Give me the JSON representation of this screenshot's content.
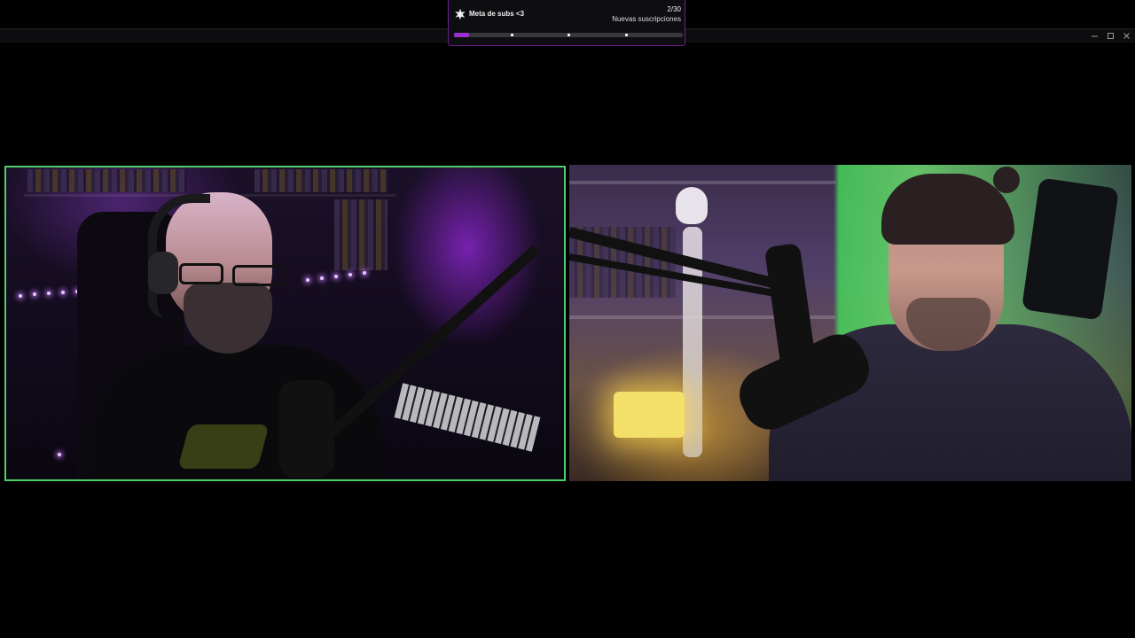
{
  "window": {
    "controls": [
      "minimize",
      "maximize",
      "close"
    ]
  },
  "goal": {
    "title": "Meta de subs <3",
    "count": "2/30",
    "subtitle": "Nuevas suscripciones",
    "progress": 0.067,
    "milestone_fractions": [
      0.25,
      0.5,
      0.75
    ],
    "icon": "star-burst-icon",
    "accent_color": "#9b2fd0",
    "border_color": "#6b1f8f"
  },
  "cameras": [
    {
      "name": "left-webcam",
      "border_color": "#4fcf6b",
      "active_speaker": true
    },
    {
      "name": "right-webcam",
      "active_speaker": false
    }
  ]
}
